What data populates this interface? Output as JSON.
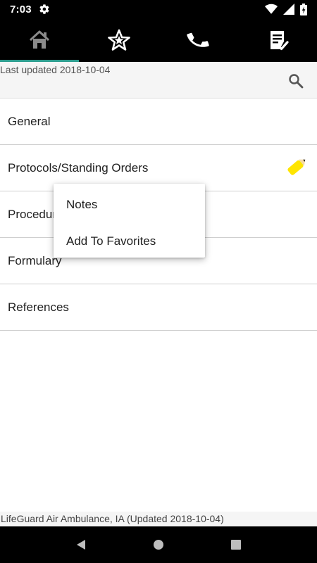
{
  "status_bar": {
    "time": "7:03"
  },
  "tabs": [
    {
      "icon": "home-icon",
      "selected": true
    },
    {
      "icon": "star-icon",
      "selected": false
    },
    {
      "icon": "phone-icon",
      "selected": false
    },
    {
      "icon": "checklist-icon",
      "selected": false
    }
  ],
  "header": {
    "last_updated": "Last updated 2018-10-04"
  },
  "list": {
    "items": [
      {
        "label": "General"
      },
      {
        "label": "Protocols/Standing Orders",
        "has_note": true
      },
      {
        "label": "Procedures"
      },
      {
        "label": "Formulary"
      },
      {
        "label": "References"
      }
    ]
  },
  "popup_menu": {
    "items": [
      {
        "label": "Notes"
      },
      {
        "label": "Add To Favorites"
      }
    ]
  },
  "footer": {
    "text": "LifeGuard Air Ambulance, IA (Updated 2018-10-04)"
  },
  "colors": {
    "toolbar": "#000000",
    "tab_indicator": "#2e9e8f",
    "note_highlight": "#ffe500"
  }
}
